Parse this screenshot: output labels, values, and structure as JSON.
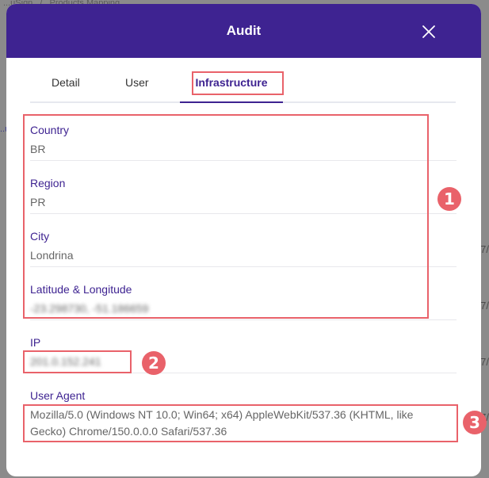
{
  "background": {
    "breadcrumb": [
      "...uSign",
      "Products Mapping"
    ],
    "breadcrumb_separator": "/",
    "left_fragment": "..uSign",
    "edge_fragments": [
      "7/",
      "7/",
      "7/",
      "7/"
    ]
  },
  "modal": {
    "title": "Audit",
    "close_icon": "close-icon"
  },
  "tabs": [
    {
      "label": "Detail",
      "active": false
    },
    {
      "label": "User",
      "active": false
    },
    {
      "label": "Infrastructure",
      "active": true
    }
  ],
  "fields": {
    "country": {
      "label": "Country",
      "value": "BR"
    },
    "region": {
      "label": "Region",
      "value": "PR"
    },
    "city": {
      "label": "City",
      "value": "Londrina"
    },
    "latlng": {
      "label": "Latitude & Longitude",
      "value": "-23.298730, -51.186659"
    },
    "ip": {
      "label": "IP",
      "value": "201.0.152.241"
    },
    "user_agent": {
      "label": "User Agent",
      "value": "Mozilla/5.0 (Windows NT 10.0; Win64; x64) AppleWebKit/537.36 (KHTML, like Gecko) Chrome/150.0.0.0 Safari/537.36"
    }
  },
  "annotations": [
    "1",
    "2",
    "3"
  ],
  "colors": {
    "header": "#3e2391",
    "accent": "#3e2391",
    "annotation": "#e9626a"
  }
}
